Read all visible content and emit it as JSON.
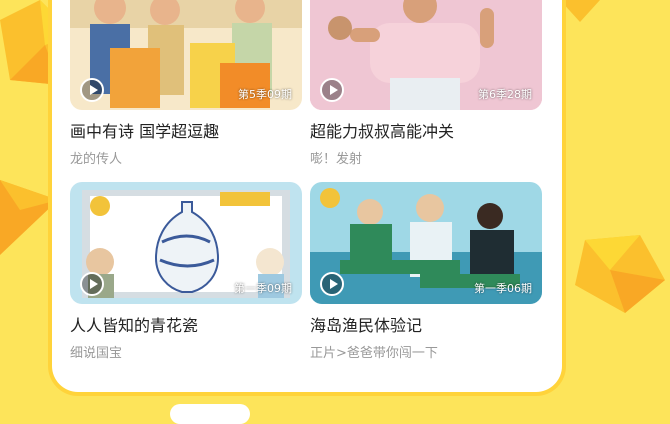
{
  "cards": [
    {
      "title": "画中有诗 国学超逗趣",
      "subtitle": "龙的传人",
      "episode": "第5季09期"
    },
    {
      "title": "超能力叔叔高能冲关",
      "subtitle": "嘭！发射",
      "episode": "第6季28期"
    },
    {
      "title": "人人皆知的青花瓷",
      "subtitle": "细说国宝",
      "episode": "第一季09期"
    },
    {
      "title": "海岛渔民体验记",
      "subtitle": "正片>爸爸带你闯一下",
      "episode": "第一季06期"
    }
  ],
  "colors": {
    "background": "#fde45a",
    "panel_border": "#ffd33a"
  }
}
